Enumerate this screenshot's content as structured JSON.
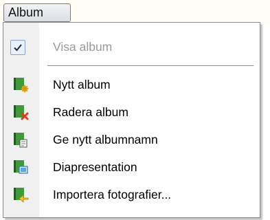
{
  "menubar": {
    "album_label": "Album"
  },
  "menu": {
    "items": [
      {
        "label": "Visa album",
        "checked": true,
        "disabled": true
      },
      {
        "label": "Nytt album",
        "icon": "album-new-icon"
      },
      {
        "label": "Radera album",
        "icon": "album-delete-icon"
      },
      {
        "label": "Ge nytt albumnamn",
        "icon": "album-rename-icon"
      },
      {
        "label": "Diapresentation",
        "icon": "slideshow-icon"
      },
      {
        "label": "Importera fotografier...",
        "icon": "import-photos-icon"
      }
    ]
  },
  "colors": {
    "book_green": "#3f9b3a",
    "book_dark": "#2d6e2a",
    "delete_red": "#e0391f",
    "new_star": "#f2b51a",
    "import_arrow": "#f2c230"
  }
}
